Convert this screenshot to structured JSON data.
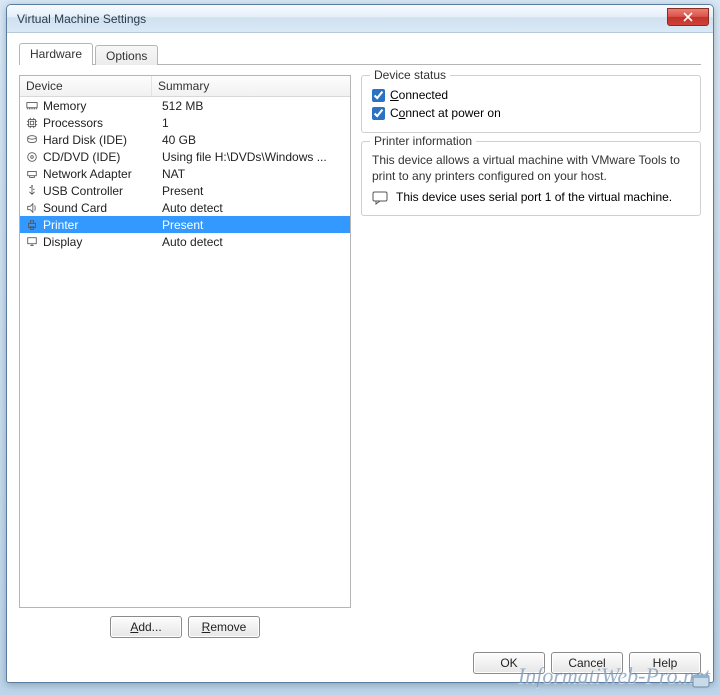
{
  "window": {
    "title": "Virtual Machine Settings"
  },
  "tabs": {
    "hardware": "Hardware",
    "options": "Options"
  },
  "columns": {
    "device": "Device",
    "summary": "Summary"
  },
  "devices": [
    {
      "icon": "memory-icon",
      "name": "Memory",
      "summary": "512 MB",
      "selected": false
    },
    {
      "icon": "cpu-icon",
      "name": "Processors",
      "summary": "1",
      "selected": false
    },
    {
      "icon": "hdd-icon",
      "name": "Hard Disk (IDE)",
      "summary": "40 GB",
      "selected": false
    },
    {
      "icon": "cd-icon",
      "name": "CD/DVD (IDE)",
      "summary": "Using file H:\\DVDs\\Windows ...",
      "selected": false
    },
    {
      "icon": "net-icon",
      "name": "Network Adapter",
      "summary": "NAT",
      "selected": false
    },
    {
      "icon": "usb-icon",
      "name": "USB Controller",
      "summary": "Present",
      "selected": false
    },
    {
      "icon": "sound-icon",
      "name": "Sound Card",
      "summary": "Auto detect",
      "selected": false
    },
    {
      "icon": "printer-icon",
      "name": "Printer",
      "summary": "Present",
      "selected": true
    },
    {
      "icon": "display-icon",
      "name": "Display",
      "summary": "Auto detect",
      "selected": false
    }
  ],
  "buttons": {
    "add": "Add...",
    "add_u": "A",
    "remove": "Remove",
    "remove_u": "R",
    "ok": "OK",
    "cancel": "Cancel",
    "help": "Help"
  },
  "status_box": {
    "legend": "Device status",
    "connected_label": "Connected",
    "connected_u": "C",
    "connected_checked": true,
    "poweron_label": "Connect at power on",
    "poweron_u": "o",
    "poweron_checked": true
  },
  "info_box": {
    "legend": "Printer information",
    "text": "This device allows a virtual machine with VMware Tools to print to any printers configured on your host.",
    "note": "This device uses serial port 1 of the virtual machine."
  },
  "watermark": "InformatiWeb-Pro.net"
}
